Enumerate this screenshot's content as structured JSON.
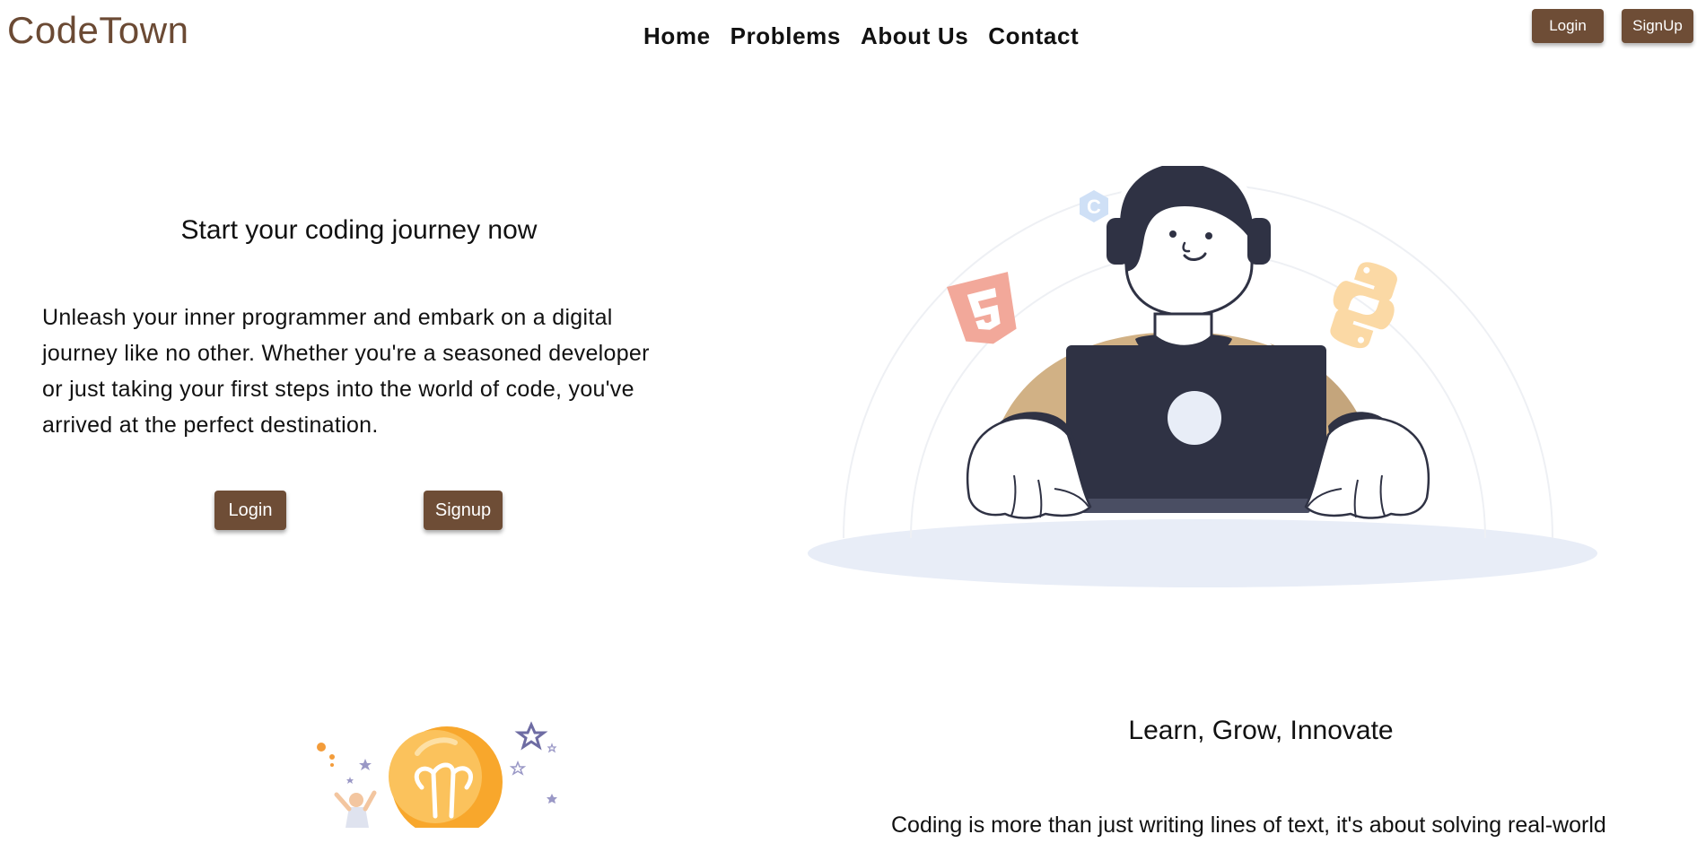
{
  "brand": {
    "name": "CodeTown"
  },
  "nav": {
    "items": [
      {
        "label": "Home"
      },
      {
        "label": "Problems"
      },
      {
        "label": "About Us"
      },
      {
        "label": "Contact"
      }
    ]
  },
  "header_buttons": {
    "login": "Login",
    "signup": "SignUp"
  },
  "hero": {
    "title": "Start your coding journey now",
    "text": "Unleash your inner programmer and embark on a digital journey like no other. Whether you're a seasoned developer or just taking your first steps into the world of code, you've arrived at the perfect destination.",
    "login_label": "Login",
    "signup_label": "Signup",
    "illustration": "developer-with-laptop-illustration",
    "icons": [
      "c-language-icon",
      "html5-icon",
      "python-icon"
    ]
  },
  "section2": {
    "title": "Learn, Grow, Innovate",
    "text": "Coding is more than just writing lines of text, it's about solving real-world",
    "illustration": "lightbulb-idea-illustration"
  },
  "colors": {
    "brand": "#6b4a34",
    "button": "#6e4d36",
    "laptop": "#2f3244",
    "shirt": "#d1b185",
    "floor": "#e8edf7"
  }
}
